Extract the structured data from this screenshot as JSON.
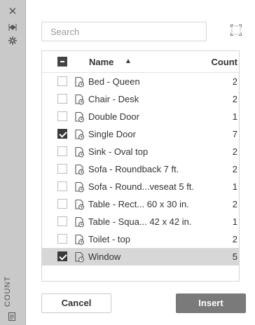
{
  "side_panel": {
    "label": "COUNT"
  },
  "search": {
    "placeholder": "Search",
    "value": ""
  },
  "table": {
    "header_name": "Name",
    "header_count": "Count",
    "rows": [
      {
        "name": "Bed - Queen",
        "count": "2",
        "checked": false
      },
      {
        "name": "Chair - Desk",
        "count": "2",
        "checked": false
      },
      {
        "name": "Double Door",
        "count": "1",
        "checked": false
      },
      {
        "name": "Single Door",
        "count": "7",
        "checked": true
      },
      {
        "name": "Sink - Oval top",
        "count": "2",
        "checked": false
      },
      {
        "name": "Sofa - Roundback 7 ft.",
        "count": "2",
        "checked": false
      },
      {
        "name": "Sofa - Round...veseat 5 ft.",
        "count": "1",
        "checked": false
      },
      {
        "name": "Table - Rect... 60 x 30 in.",
        "count": "2",
        "checked": false
      },
      {
        "name": "Table - Squa... 42 x 42 in.",
        "count": "1",
        "checked": false
      },
      {
        "name": "Toilet - top",
        "count": "2",
        "checked": false
      },
      {
        "name": "Window",
        "count": "5",
        "checked": true,
        "selected": true
      }
    ]
  },
  "buttons": {
    "cancel": "Cancel",
    "insert": "Insert"
  },
  "colors": {
    "strip_bg": "#c9c9c9",
    "selected_row_bg": "#d7d7d7",
    "insert_bg": "#7a7a7a"
  }
}
